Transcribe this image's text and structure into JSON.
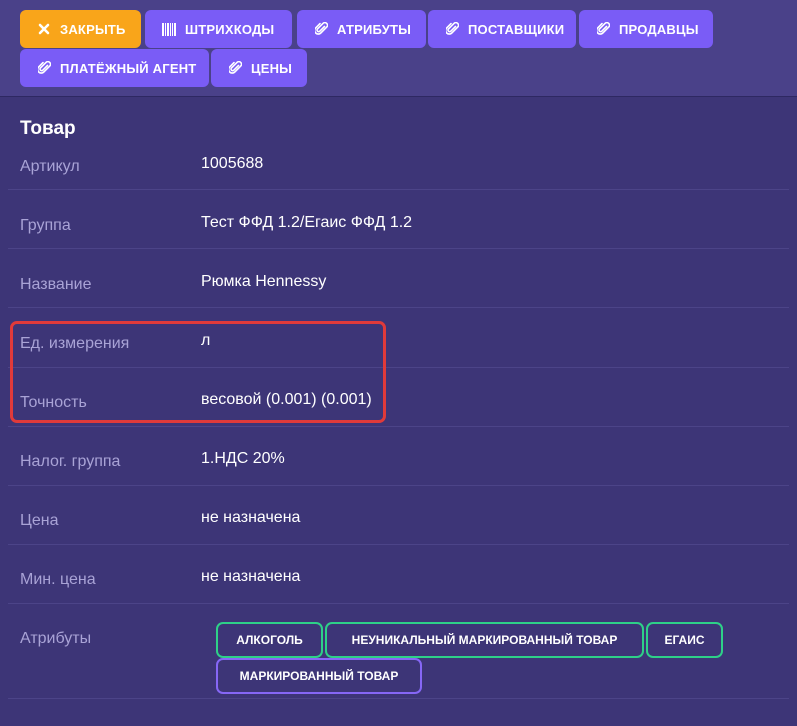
{
  "toolbar": {
    "buttons": [
      {
        "label": "ЗАКРЫТЬ",
        "icon": "close-icon"
      },
      {
        "label": "ШТРИХКОДЫ",
        "icon": "barcode-icon"
      },
      {
        "label": "АТРИБУТЫ",
        "icon": "paperclip-icon"
      },
      {
        "label": "ПОСТАВЩИКИ",
        "icon": "paperclip-icon"
      },
      {
        "label": "ПРОДАВЦЫ",
        "icon": "paperclip-icon"
      },
      {
        "label": "ПЛАТЁЖНЫЙ АГЕНТ",
        "icon": "paperclip-icon"
      },
      {
        "label": "ЦЕНЫ",
        "icon": "paperclip-icon"
      }
    ],
    "colors": {
      "close": "#f9a51a",
      "primary": "#7a5cf6"
    }
  },
  "product": {
    "title": "Товар",
    "rows": [
      {
        "label": "Артикул",
        "value": "1005688"
      },
      {
        "label": "Группа",
        "value": "Тест ФФД 1.2/Егаис ФФД 1.2"
      },
      {
        "label": "Название",
        "value": "Рюмка Hennessy"
      },
      {
        "label": "Ед. измерения",
        "value": "л"
      },
      {
        "label": "Точность",
        "value": "весовой (0.001) (0.001)"
      },
      {
        "label": "Налог. группа",
        "value": "1.НДС 20%"
      },
      {
        "label": "Цена",
        "value": "не назначена"
      },
      {
        "label": "Мин. цена",
        "value": "не назначена"
      }
    ],
    "attributes": {
      "label": "Атрибуты",
      "tags": [
        {
          "label": "АЛКОГОЛЬ",
          "color": "#2ed088"
        },
        {
          "label": "НЕУНИКАЛЬНЫЙ МАРКИРОВАННЫЙ ТОВАР",
          "color": "#2ed088"
        },
        {
          "label": "ЕГАИС",
          "color": "#2ed088"
        },
        {
          "label": "МАРКИРОВАННЫЙ ТОВАР",
          "color": "#8667f6"
        }
      ]
    }
  },
  "highlight_color": "#e03a3a"
}
